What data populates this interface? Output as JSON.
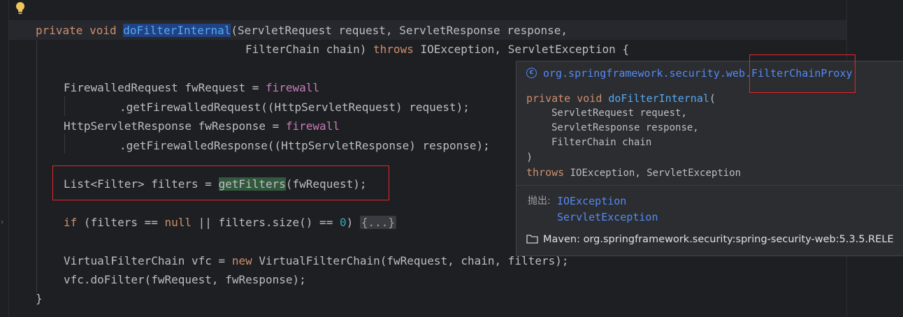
{
  "code": {
    "line1": {
      "kw_private": "private",
      "kw_void": "void",
      "method": "doFilterInternal",
      "params_1": "(ServletRequest request, ServletResponse response,"
    },
    "line2": {
      "params_2": "FilterChain chain) ",
      "kw_throws": "throws",
      "exceptions": " IOException, ServletException {"
    },
    "line4": {
      "decl": "FirewalledRequest fwRequest = ",
      "field": "firewall"
    },
    "line5": {
      "call": ".getFirewalledRequest((HttpServletRequest) request);"
    },
    "line6": {
      "decl": "HttpServletResponse fwResponse = ",
      "field": "firewall"
    },
    "line7": {
      "call": ".getFirewalledResponse((HttpServletResponse) response);"
    },
    "line9": {
      "type": "List<Filter> filters = ",
      "call_name": "getFilters",
      "args": "(fwRequest);"
    },
    "line11": {
      "kw_if": "if",
      "cond_1": " (filters == ",
      "kw_null": "null",
      "cond_2": " || filters.size() == ",
      "num_zero": "0",
      "cond_3": ") ",
      "folded": "{...}"
    },
    "line13": {
      "decl": "VirtualFilterChain vfc = ",
      "kw_new": "new",
      "ctor": " VirtualFilterChain(fwRequest, chain, filters);"
    },
    "line14": {
      "stmt": "vfc.doFilter(fwRequest, fwResponse);"
    },
    "line15": {
      "brace": "}"
    }
  },
  "popup": {
    "package": "org.springframework.security.web.",
    "class_name": "FilterChainProxy",
    "class_icon": "c",
    "sig_kw_private": "private",
    "sig_kw_void": "void",
    "sig_method": "doFilterInternal",
    "sig_open": "(",
    "param1_type": "ServletRequest",
    "param1_name": " request,",
    "param2_type": "ServletResponse",
    "param2_name": " response,",
    "param3_type": "FilterChain",
    "param3_name": " chain",
    "sig_close": ")",
    "sig_kw_throws": "throws",
    "sig_exceptions": " IOException, ServletException",
    "throws_label": "抛出:",
    "throws_1": "IOException",
    "throws_2": "ServletException",
    "maven_icon": "folder-icon",
    "maven_text": "Maven: org.springframework.security:spring-security-web:5.3.5.RELE"
  },
  "colors": {
    "keyword": "#cf8e6d",
    "method": "#56a8f5",
    "field": "#c77dba",
    "number": "#2aacb8",
    "annotation_box": "#e5262b"
  }
}
